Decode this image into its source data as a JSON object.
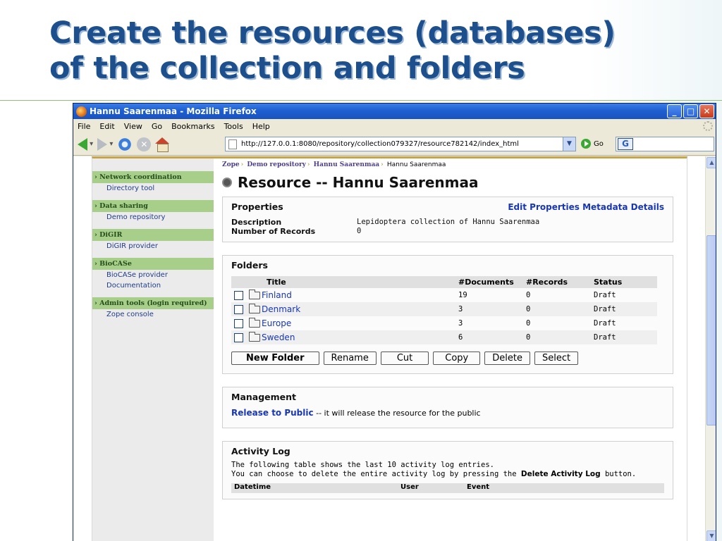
{
  "slide": {
    "title_line1": "Create the resources (databases)",
    "title_line2": "of the collection and folders"
  },
  "window": {
    "title": "Hannu Saarenmaa - Mozilla Firefox",
    "menu": [
      "File",
      "Edit",
      "View",
      "Go",
      "Bookmarks",
      "Tools",
      "Help"
    ],
    "url": "http://127.0.0.1:8080/repository/collection079327/resource782142/index_html",
    "go_label": "Go"
  },
  "sidebar": {
    "groups": [
      {
        "head": "Network coordination",
        "items": [
          "Directory tool"
        ]
      },
      {
        "head": "Data sharing",
        "items": [
          "Demo repository"
        ]
      },
      {
        "head": "DiGIR",
        "items": [
          "DiGIR provider"
        ]
      },
      {
        "head": "BioCASe",
        "items": [
          "BioCASe provider",
          "Documentation"
        ]
      },
      {
        "head": "Admin tools (login required)",
        "items": [
          "Zope console"
        ]
      }
    ]
  },
  "breadcrumb": {
    "items": [
      "Zope",
      "Demo repository",
      "Hannu Saarenmaa"
    ],
    "current": "Hannu Saarenmaa"
  },
  "heading": "Resource -- Hannu Saarenmaa",
  "properties": {
    "title": "Properties",
    "links": "Edit Properties Metadata Details",
    "description_label": "Description",
    "description_value": "Lepidoptera collection of Hannu Saarenmaa",
    "records_label": "Number of Records",
    "records_value": "0"
  },
  "folders": {
    "title": "Folders",
    "columns": [
      "Title",
      "#Documents",
      "#Records",
      "Status"
    ],
    "rows": [
      {
        "title": "Finland",
        "documents": "19",
        "records": "0",
        "status": "Draft"
      },
      {
        "title": "Denmark",
        "documents": "3",
        "records": "0",
        "status": "Draft"
      },
      {
        "title": "Europe",
        "documents": "3",
        "records": "0",
        "status": "Draft"
      },
      {
        "title": "Sweden",
        "documents": "6",
        "records": "0",
        "status": "Draft"
      }
    ],
    "buttons": {
      "new_folder": "New Folder",
      "rename": "Rename",
      "cut": "Cut",
      "copy": "Copy",
      "delete": "Delete",
      "select": "Select"
    }
  },
  "management": {
    "title": "Management",
    "link": "Release to Public",
    "text": " -- it will release the resource for the public"
  },
  "activity_log": {
    "title": "Activity Log",
    "line1": "The following table shows the last 10 activity log entries.",
    "line2_pre": "You can choose to delete the entire activity log by pressing the ",
    "line2_bold": "Delete Activity Log",
    "line2_post": " button.",
    "partial_columns": [
      "Datetime",
      "User",
      "Event"
    ]
  }
}
